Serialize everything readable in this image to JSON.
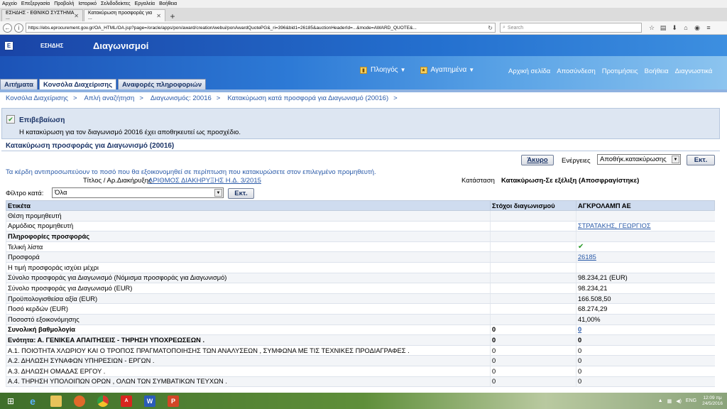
{
  "browser": {
    "menu": [
      "Αρχείο",
      "Επεξεργασία",
      "Προβολή",
      "Ιστορικό",
      "Σελιδοδείκτες",
      "Εργαλεία",
      "Βοήθεια"
    ],
    "tabs": [
      {
        "label": "ΕΣΗΔΗΣ - ΕΘΝΙΚΟ ΣΥΣΤΗΜΑ ..."
      },
      {
        "label": "Κατακύρωση προσφοράς για ..."
      }
    ],
    "url": "https://ebs.eprocurement.gov.gr/OA_HTML/OA.jsp?page=/oracle/apps/pon/award/creation/webui/ponAwardQuotePG&_ri=396&bid1=26185&auctionHeaderId=...&mode=AWARD_QUOTE&...",
    "search_placeholder": "Search"
  },
  "header": {
    "brand": "ΕΣΗΔΗΣ",
    "app_title": "Διαγωνισμοί",
    "logo_letter": "Ε",
    "dropdowns": [
      {
        "label": "Πλοηγός"
      },
      {
        "label": "Αγαπημένα"
      }
    ],
    "global_links": [
      "Αρχική σελίδα",
      "Αποσύνδεση",
      "Προτιμήσεις",
      "Βοήθεια",
      "Διαγνωστικά"
    ],
    "tabs": [
      {
        "label": "Αιτήματα",
        "active": false
      },
      {
        "label": "Κονσόλα Διαχείρισης",
        "active": true
      },
      {
        "label": "Αναφορές πληροφοριών",
        "active": false
      }
    ]
  },
  "breadcrumb": [
    "Κονσόλα Διαχείρισης",
    "Απλή αναζήτηση",
    "Διαγωνισμός: 20016",
    "Κατακύρωση κατά προσφορά για Διαγωνισμό (20016)"
  ],
  "confirmation": {
    "title": "Επιβεβαίωση",
    "message": "Η κατακύρωση για τον διαγωνισμό 20016 έχει αποθηκευτεί ως προσχέδιο."
  },
  "page": {
    "title": "Κατακύρωση προσφοράς για Διαγωνισμό (20016)",
    "cancel_label": "Άκυρο",
    "actions_label": "Ενέργειες",
    "actions_selected": "Αποθήκ.κατακύρωσης",
    "go_label": "Εκτ.",
    "hint": "Τα κέρδη αντιπροσωπεύουν το ποσό που θα εξοικονομηθεί σε περίπτωση που κατακυρώσετε στον επιλεγμένο προμηθευτή.",
    "title_label": "Τίτλος / Αρ.Διακήρυξης",
    "title_value": "ΑΡΙΘΜΟΣ ΔΙΑΚΗΡΥΞΗΣ Η.Δ. 3/2015",
    "status_label": "Κατάσταση",
    "status_value": "Κατακύρωση-Σε εξέλιξη (Αποσφραγίστηκε)",
    "filter_label": "Φίλτρο κατά:",
    "filter_value": "Όλα"
  },
  "table": {
    "headers": [
      "Ετικέτα",
      "Στόχοι διαγωνισμού",
      "ΑΓΚΡΟΛΑΜΠ ΑΕ"
    ],
    "rows": [
      {
        "label": "Θέση προμηθευτή",
        "target": "",
        "value": ""
      },
      {
        "label": "Αρμόδιος προμηθευτή",
        "target": "",
        "value": "ΣΤΡΑΤΑΚΗΣ, ΓΕΩΡΓΙΟΣ",
        "link": true
      },
      {
        "label": "Πληροφορίες προσφοράς",
        "target": "",
        "value": "",
        "bold": true
      },
      {
        "label": "Τελική λίστα",
        "target": "",
        "value": "✔",
        "check": true
      },
      {
        "label": "Προσφορά",
        "target": "",
        "value": "26185",
        "link": true
      },
      {
        "label": "Η τιμή προσφοράς ισχύει μέχρι",
        "target": "",
        "value": ""
      },
      {
        "label": "Σύνολο προσφοράς για Διαγωνισμό (Νόμισμα προσφοράς για Διαγωνισμό)",
        "target": "",
        "value": "98.234,21 (EUR)"
      },
      {
        "label": "Σύνολο προσφοράς για Διαγωνισμό (EUR)",
        "target": "",
        "value": "98.234,21"
      },
      {
        "label": "Προϋπολογισθείσα αξία (EUR)",
        "target": "",
        "value": "166.508,50"
      },
      {
        "label": "Ποσό κερδών (EUR)",
        "target": "",
        "value": "68.274,29"
      },
      {
        "label": "Ποσοστό εξοικονόμησης",
        "target": "",
        "value": "41,00%"
      },
      {
        "label": "Συνολική βαθμολογία",
        "target": "0",
        "value": "0",
        "bold": true,
        "link": true
      },
      {
        "label": "Ενότητα: Α. ΓΕΝΙΚΕΑ ΑΠΑΙΤΗΣΕΙΣ - ΤΗΡΗΣΗ ΥΠΟΧΡΕΩΣΕΩΝ .",
        "target": "0",
        "value": "0",
        "bold": true
      },
      {
        "label": "Α.1. ΠΟΙΟΤΗΤΑ ΧΛΩΡΙΟΥ ΚΑΙ Ο ΤΡΟΠΟΣ ΠΡΑΓΜΑΤΟΠΟΙΗΣΗΣ ΤΩΝ ΑΝΑΛΥΣΕΩΝ , ΣΥΜΦΩΝΑ ΜΕ ΤΙΣ ΤΕΧΝΙΚΕΣ ΠΡΟΔΙΑΓΡΑΦΕΣ .",
        "target": "0",
        "value": "0"
      },
      {
        "label": "Α.2. ΔΗΛΩΣΗ ΣΥΝΑΦΩΝ ΥΠΗΡΕΣΙΩΝ - ΕΡΓΩΝ .",
        "target": "0",
        "value": "0"
      },
      {
        "label": "Α.3. ΔΗΛΩΣΗ ΟΜΑΔΑΣ ΕΡΓΟΥ .",
        "target": "0",
        "value": "0"
      },
      {
        "label": "Α.4. ΤΗΡΗΣΗ ΥΠΟΛΟΙΠΩΝ ΟΡΩΝ , ΟΛΩΝ ΤΩΝ ΣΥΜΒΑΤΙΚΩΝ ΤΕΥΧΩΝ .",
        "target": "0",
        "value": "0"
      }
    ]
  },
  "taskbar": {
    "lang": "ENG",
    "time": "12:09 πμ",
    "date": "24/5/2016"
  }
}
